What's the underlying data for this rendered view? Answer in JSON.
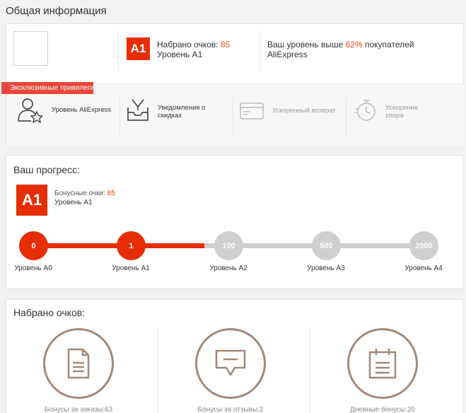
{
  "page_title": "Общая информация",
  "info": {
    "badge": "A1",
    "points_label": "Набрано очков:",
    "points_value": "85",
    "level_text": "Уровень A1",
    "rank_prefix": "Ваш уровень выше",
    "rank_percent": "62%",
    "rank_suffix": "покупателей",
    "rank_line2": "AliExpress"
  },
  "privileges": {
    "ribbon": "Эксклюзивные привилегии",
    "items": [
      {
        "icon": "user-star-icon",
        "label": "Уровень AliExpress",
        "active": true
      },
      {
        "icon": "envelope-tray-icon",
        "label": "Уведомления о скидках",
        "active": true
      },
      {
        "icon": "wallet-icon",
        "label": "Ускоренный возврат",
        "active": false
      },
      {
        "icon": "stopwatch-icon",
        "label": "Ускорение спора",
        "active": false
      }
    ]
  },
  "progress": {
    "title": "Ваш прогресс:",
    "badge": "A1",
    "bonus_label": "Бонусные очки:",
    "bonus_value": "85",
    "level_text": "Уровень A1",
    "nodes": [
      {
        "value": "0",
        "label": "Уровень A0",
        "reached": true
      },
      {
        "value": "1",
        "label": "Уровень A1",
        "reached": true
      },
      {
        "value": "100",
        "label": "Уровень A2",
        "reached": false
      },
      {
        "value": "500",
        "label": "Уровень A3",
        "reached": false
      },
      {
        "value": "2000",
        "label": "Уровень A4",
        "reached": false
      }
    ],
    "accent": "#e62e04",
    "inactive": "#cfcfcf"
  },
  "points": {
    "title": "Набрано очков:",
    "items": [
      {
        "icon": "document-icon",
        "caption": "Бонусы за заказы:63"
      },
      {
        "icon": "speech-bubble-icon",
        "caption": "Бонусы за отзывы:2"
      },
      {
        "icon": "calendar-icon",
        "caption": "Дневные бонусы:20"
      }
    ]
  }
}
